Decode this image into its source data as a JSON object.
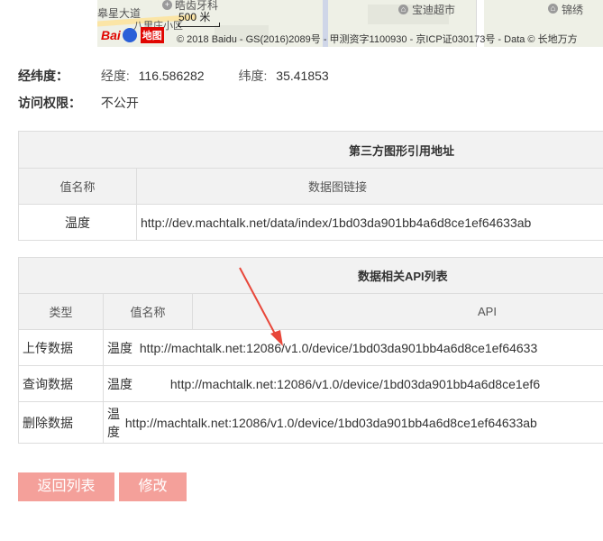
{
  "map": {
    "labels": [
      "皋星大道",
      "晧齿牙科",
      "八里庄小区",
      "宝迪超市",
      "锦绣"
    ],
    "scale": "500 米",
    "logo_text": "Bai",
    "logo_map": "地图",
    "copyright": "© 2018 Baidu - GS(2016)2089号 - 甲测资字1100930 - 京ICP证030173号 - Data © 长地万方"
  },
  "info": {
    "coords_label": "经纬度：",
    "lng_key": "经度:",
    "lng_val": "116.586282",
    "lat_key": "纬度:",
    "lat_val": "35.41853",
    "access_label": "访问权限：",
    "access_val": "不公开"
  },
  "table1": {
    "caption": "第三方图形引用地址",
    "headers": [
      "值名称",
      "数据图链接"
    ],
    "rows": [
      [
        "温度",
        "http://dev.machtalk.net/data/index/1bd03da901bb4a6d8ce1ef64633ab"
      ]
    ]
  },
  "table2": {
    "caption": "数据相关API列表",
    "headers": [
      "类型",
      "值名称",
      "API"
    ],
    "rows": [
      [
        "上传数据",
        "温度",
        "http://machtalk.net:12086/v1.0/device/1bd03da901bb4a6d8ce1ef64633"
      ],
      [
        "查询数据",
        "温度",
        "http://machtalk.net:12086/v1.0/device/1bd03da901bb4a6d8ce1ef6"
      ],
      [
        "删除数据",
        "温度",
        "http://machtalk.net:12086/v1.0/device/1bd03da901bb4a6d8ce1ef64633ab"
      ]
    ]
  },
  "buttons": {
    "back": "返回列表",
    "edit": "修改"
  },
  "colors": {
    "button_bg": "#f4a09a",
    "arrow": "#e8473a",
    "header_bg": "#f2f2f2"
  }
}
